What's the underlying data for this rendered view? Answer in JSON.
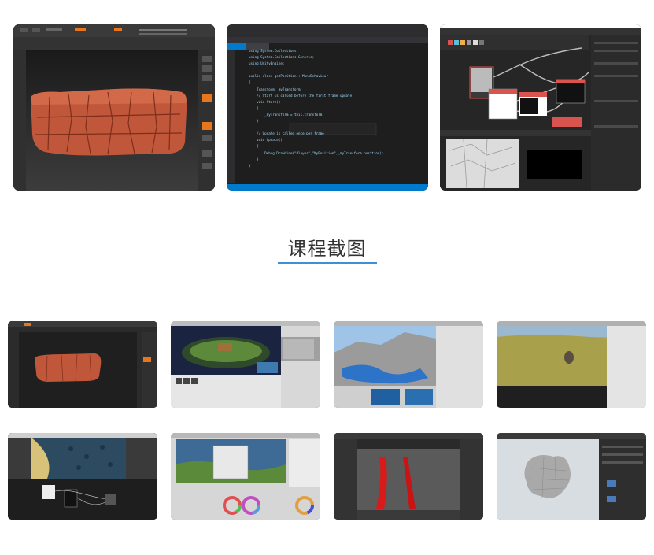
{
  "section": {
    "title": "课程截图"
  },
  "colors": {
    "accent": "#3d8fd6",
    "title_text": "#333333",
    "clay": "#c0573a",
    "ui_dark": "#2a2a2a",
    "orange_toolbar": "#e8761c"
  },
  "screenshots_top": [
    {
      "id": "zbrush-rock-sculpt",
      "app": "sculpting viewport"
    },
    {
      "id": "visual-studio-code",
      "app": "code editor"
    },
    {
      "id": "substance-node-graph",
      "app": "node graph"
    }
  ],
  "code_editor": {
    "lines": [
      "using System.Collections;",
      "using System.Collections.Generic;",
      "using UnityEngine;",
      "",
      "public class getPosition : MonoBehaviour",
      "{",
      "    Transform _myTransform;",
      "    // Start is called before the first frame update",
      "    void Start()",
      "    {",
      "        _myTransform = this.transform;",
      "    }",
      "",
      "    // Update is called once per frame",
      "    void Update()",
      "    {",
      "        Debug.DrawLine(\"Player\",\"MyPosition\",_myTransform.position);",
      "    }",
      "}"
    ]
  },
  "screenshots_grid": [
    {
      "id": "grid-zbrush-rock"
    },
    {
      "id": "grid-stylized-island"
    },
    {
      "id": "grid-terrain-blockout"
    },
    {
      "id": "grid-grass-field"
    },
    {
      "id": "grid-beach-nodes"
    },
    {
      "id": "grid-color-grading"
    },
    {
      "id": "grid-red-curves"
    },
    {
      "id": "grid-rock-mesh"
    }
  ]
}
